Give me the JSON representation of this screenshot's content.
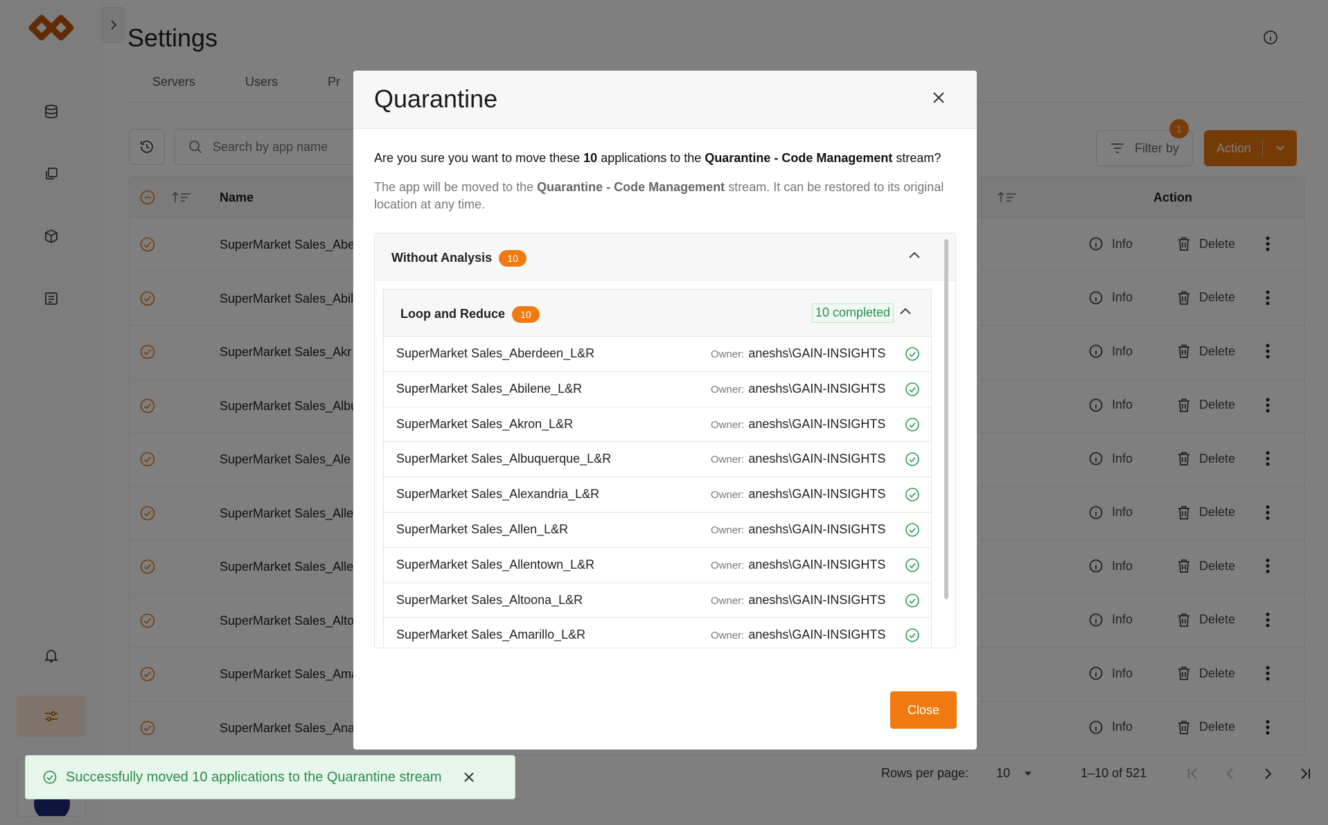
{
  "page": {
    "title": "Settings",
    "tabs": [
      "Servers",
      "Users",
      "Pr"
    ]
  },
  "search": {
    "placeholder": "Search by app name"
  },
  "toolbar": {
    "filter_label": "Filter by",
    "filter_count": "1",
    "action_label": "Action"
  },
  "table": {
    "headers": {
      "name": "Name",
      "action": "Action"
    },
    "row_info_label": "Info",
    "row_delete_label": "Delete",
    "rows": [
      "SuperMarket Sales_Abe",
      "SuperMarket Sales_Abil",
      "SuperMarket Sales_Akr",
      "SuperMarket Sales_Albu",
      "SuperMarket Sales_Ale",
      "SuperMarket Sales_Alle",
      "SuperMarket Sales_Alle",
      "SuperMarket Sales_Alto",
      "SuperMarket Sales_Ama",
      "SuperMarket Sales_Ana"
    ]
  },
  "pagination": {
    "rows_per_page_label": "Rows per page:",
    "rows_per_page": "10",
    "range": "1–10 of 521"
  },
  "modal": {
    "title": "Quarantine",
    "confirm_prefix": "Are you sure you want to move these ",
    "confirm_count": "10",
    "confirm_mid": " applications to the ",
    "stream_name": "Quarantine - Code Management",
    "confirm_suffix": " stream?",
    "sub_prefix": "The app will be moved to the ",
    "sub_suffix": " stream. It can be restored to its original location at any time.",
    "group": {
      "title": "Without Analysis",
      "count": "10"
    },
    "subgroup": {
      "title": "Loop and Reduce",
      "count": "10",
      "status": "10 completed"
    },
    "owner_label": "Owner:",
    "items": [
      {
        "name": "SuperMarket Sales_Aberdeen_L&R",
        "owner": "aneshs\\GAIN-INSIGHTS"
      },
      {
        "name": "SuperMarket Sales_Abilene_L&R",
        "owner": "aneshs\\GAIN-INSIGHTS"
      },
      {
        "name": "SuperMarket Sales_Akron_L&R",
        "owner": "aneshs\\GAIN-INSIGHTS"
      },
      {
        "name": "SuperMarket Sales_Albuquerque_L&R",
        "owner": "aneshs\\GAIN-INSIGHTS"
      },
      {
        "name": "SuperMarket Sales_Alexandria_L&R",
        "owner": "aneshs\\GAIN-INSIGHTS"
      },
      {
        "name": "SuperMarket Sales_Allen_L&R",
        "owner": "aneshs\\GAIN-INSIGHTS"
      },
      {
        "name": "SuperMarket Sales_Allentown_L&R",
        "owner": "aneshs\\GAIN-INSIGHTS"
      },
      {
        "name": "SuperMarket Sales_Altoona_L&R",
        "owner": "aneshs\\GAIN-INSIGHTS"
      },
      {
        "name": "SuperMarket Sales_Amarillo_L&R",
        "owner": "aneshs\\GAIN-INSIGHTS"
      }
    ],
    "close_label": "Close"
  },
  "toast": {
    "message": "Successfully moved 10 applications to the Quarantine stream"
  },
  "colors": {
    "accent": "#e8760e",
    "success": "#2e8b4e",
    "brand_logo": "#c4570b"
  }
}
